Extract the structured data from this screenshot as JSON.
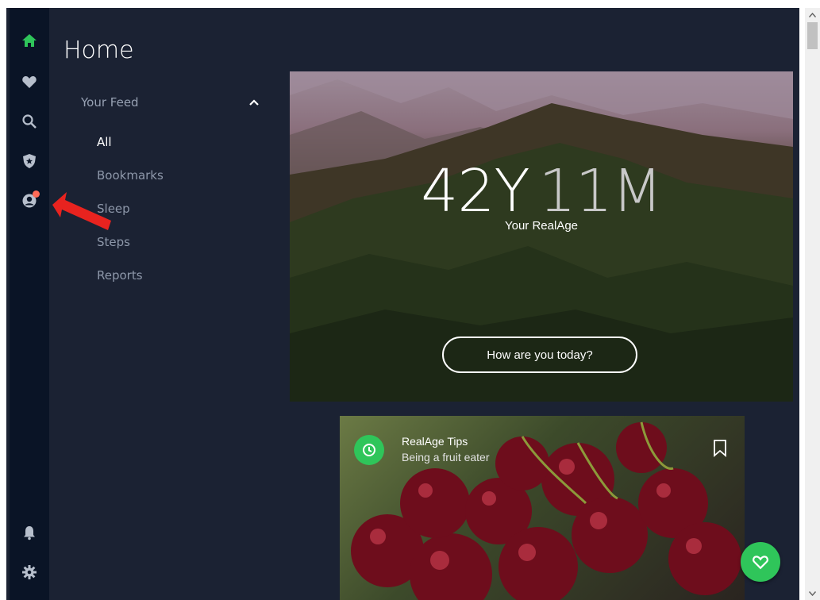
{
  "page": {
    "title": "Home"
  },
  "rail": {
    "icons": [
      "home-icon",
      "heart-icon",
      "search-icon",
      "shield-star-icon",
      "profile-icon",
      "bell-icon",
      "gear-icon"
    ],
    "active_color": "#2fc55a",
    "notification_color": "#ff6b57"
  },
  "feed": {
    "header": "Your Feed",
    "items": [
      {
        "label": "All"
      },
      {
        "label": "Bookmarks"
      },
      {
        "label": "Sleep"
      },
      {
        "label": "Steps"
      },
      {
        "label": "Reports"
      }
    ],
    "active_index": 0
  },
  "hero": {
    "years": "42Y",
    "months": "11M",
    "caption": "Your RealAge",
    "button_label": "How are you today?"
  },
  "tip_card": {
    "title": "RealAge Tips",
    "subtitle": "Being a fruit eater"
  },
  "annotation": {
    "arrow_color": "#e8231f"
  }
}
